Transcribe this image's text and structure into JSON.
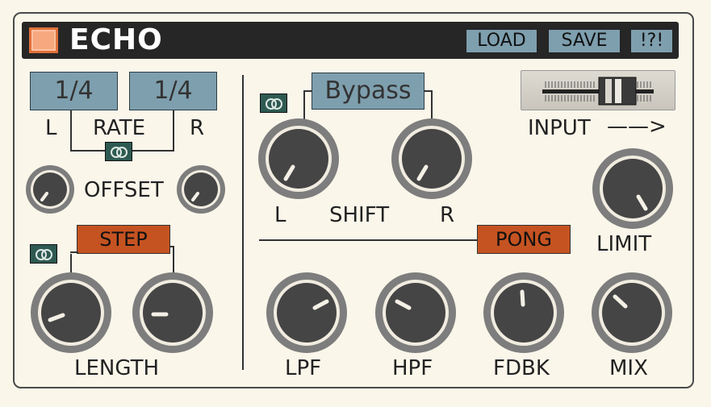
{
  "title": "ECHO",
  "header_buttons": {
    "load": "LOAD",
    "save": "SAVE",
    "help": "!?!"
  },
  "rate": {
    "left_value": "1/4",
    "right_value": "1/4",
    "label": "RATE",
    "l": "L",
    "r": "R"
  },
  "offset": {
    "label": "OFFSET"
  },
  "step": {
    "label": "STEP"
  },
  "length": {
    "label": "LENGTH"
  },
  "shift": {
    "mode": "Bypass",
    "label": "SHIFT",
    "l": "L",
    "r": "R"
  },
  "input": {
    "label": "INPUT",
    "arrow": "——>"
  },
  "limit": {
    "label": "LIMIT"
  },
  "pong": {
    "label": "PONG"
  },
  "filters": {
    "lpf": "LPF",
    "hpf": "HPF",
    "fdbk": "FDBK",
    "mix": "MIX"
  },
  "colors": {
    "accent": "#c55321",
    "value_box": "#7e9fae",
    "link": "#2e5a52",
    "background": "#fbf6ea"
  },
  "icons": {
    "link": "link-rings-icon",
    "power": "power-led-icon"
  }
}
